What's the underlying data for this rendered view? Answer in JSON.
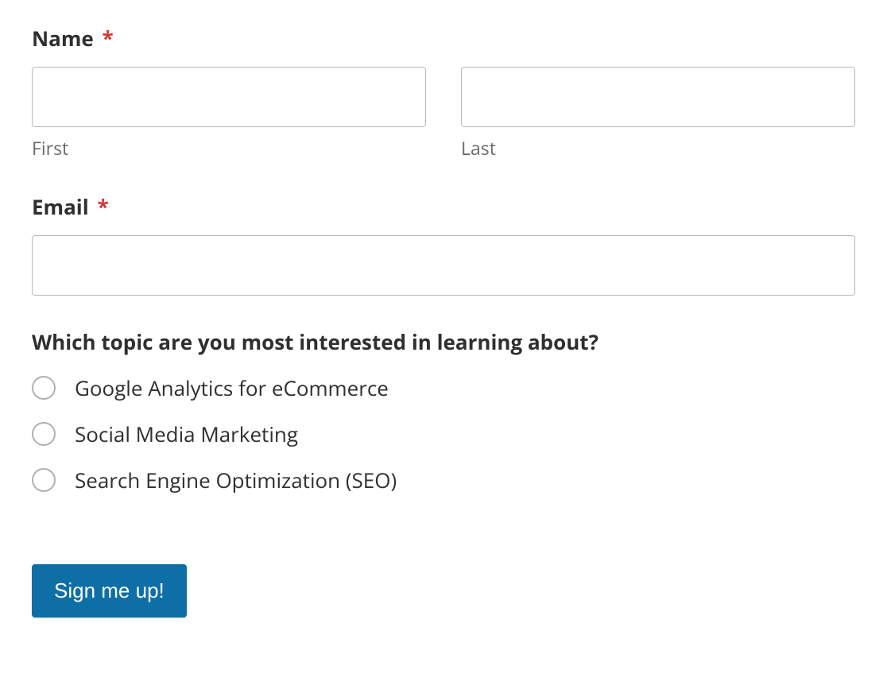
{
  "form": {
    "name": {
      "label": "Name",
      "required_marker": "*",
      "first": {
        "value": "",
        "sublabel": "First"
      },
      "last": {
        "value": "",
        "sublabel": "Last"
      }
    },
    "email": {
      "label": "Email",
      "required_marker": "*",
      "value": ""
    },
    "topic": {
      "question": "Which topic are you most interested in learning about?",
      "options": [
        "Google Analytics for eCommerce",
        "Social Media Marketing",
        "Search Engine Optimization (SEO)"
      ]
    },
    "submit_label": "Sign me up!"
  },
  "colors": {
    "required": "#d63638",
    "button_bg": "#0e6fa6"
  }
}
